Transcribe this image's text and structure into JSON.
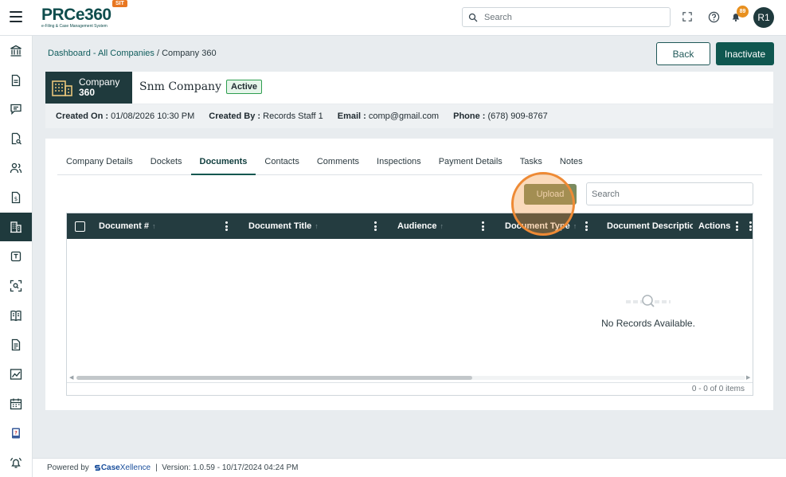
{
  "app": {
    "logo_text": "PRCe360",
    "logo_subtitle": "e-Filing & Case Management System",
    "env_badge": "SIT"
  },
  "topbar": {
    "search_placeholder": "Search",
    "notification_count": "89",
    "avatar_initials": "R1",
    "icons": [
      "hamburger-icon",
      "fullscreen-icon",
      "help-icon",
      "bell-icon"
    ]
  },
  "sidebar": {
    "items": [
      {
        "name": "bank-icon",
        "active": false
      },
      {
        "name": "document-icon",
        "active": false
      },
      {
        "name": "chat-icon",
        "active": false
      },
      {
        "name": "file-search-icon",
        "active": false
      },
      {
        "name": "users-icon",
        "active": false
      },
      {
        "name": "dollar-file-icon",
        "active": false
      },
      {
        "name": "building-icon",
        "active": true
      },
      {
        "name": "note-icon",
        "active": false
      },
      {
        "name": "scan-icon",
        "active": false
      },
      {
        "name": "book-icon",
        "active": false
      },
      {
        "name": "page-icon",
        "active": false
      },
      {
        "name": "chart-icon",
        "active": false
      },
      {
        "name": "calendar-icon",
        "active": false
      },
      {
        "name": "help-book-icon",
        "active": false
      },
      {
        "name": "alarm-icon",
        "active": false
      }
    ]
  },
  "breadcrumb": {
    "link": "Dashboard - All Companies",
    "separator": " / ",
    "current": "Company 360"
  },
  "actions": {
    "back_label": "Back",
    "inactivate_label": "Inactivate"
  },
  "header": {
    "badge_line1": "Company",
    "badge_line2": "360",
    "company_name": "Snm Company",
    "status": "Active"
  },
  "info": {
    "created_on_label": "Created On :",
    "created_on_value": "01/08/2026 10:30 PM",
    "created_by_label": "Created By :",
    "created_by_value": "Records Staff 1",
    "email_label": "Email :",
    "email_value": "comp@gmail.com",
    "phone_label": "Phone :",
    "phone_value": "(678) 909-8767"
  },
  "tabs": [
    {
      "label": "Company Details",
      "active": false
    },
    {
      "label": "Dockets",
      "active": false
    },
    {
      "label": "Documents",
      "active": true
    },
    {
      "label": "Contacts",
      "active": false
    },
    {
      "label": "Comments",
      "active": false
    },
    {
      "label": "Inspections",
      "active": false
    },
    {
      "label": "Payment Details",
      "active": false
    },
    {
      "label": "Tasks",
      "active": false
    },
    {
      "label": "Notes",
      "active": false
    }
  ],
  "documents": {
    "upload_label": "Upload",
    "search_placeholder": "Search",
    "columns": [
      "Document #",
      "Document Title",
      "Audience",
      "Document Type",
      "Document Descriptio",
      "Actions"
    ],
    "empty_text": "No Records Available.",
    "pager_text": "0 - 0 of 0 items"
  },
  "footer": {
    "powered_by": "Powered by",
    "brand_prefix": "Case",
    "brand_suffix": "Xellence",
    "version": "Version: 1.0.59 - 10/17/2024 04:24 PM"
  },
  "colors": {
    "primary": "#0f5750",
    "sidebar_active": "#1f3a3d",
    "status_green": "#2e9e4f",
    "highlight_orange": "#ee8a35"
  }
}
